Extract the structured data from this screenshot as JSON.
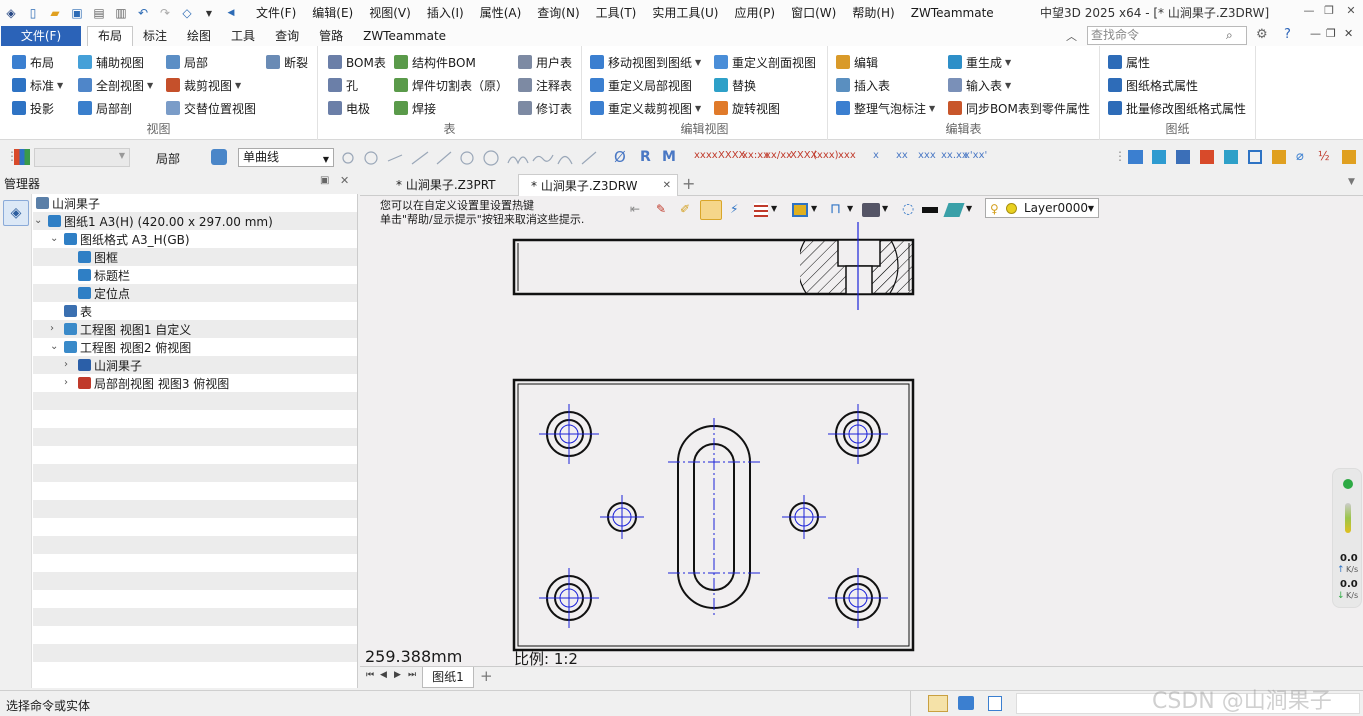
{
  "titlebar": {
    "menus": [
      "文件(F)",
      "编辑(E)",
      "视图(V)",
      "插入(I)",
      "属性(A)",
      "查询(N)",
      "工具(T)",
      "实用工具(U)",
      "应用(P)",
      "窗口(W)",
      "帮助(H)",
      "ZWTeammate"
    ],
    "title": "中望3D 2025 x64 - [* 山涧果子.Z3DRW]"
  },
  "tabs": {
    "file": "文件(F)",
    "items": [
      "布局",
      "标注",
      "绘图",
      "工具",
      "查询",
      "管路",
      "ZWTeammate"
    ],
    "active": "布局",
    "search_placeholder": "查找命令"
  },
  "ribbon": {
    "view": {
      "label": "视图",
      "items": [
        "布局",
        "辅助视图",
        "局部",
        "断裂",
        "标准",
        "全剖视图",
        "裁剪视图",
        "投影",
        "局部剖",
        "交替位置视图"
      ]
    },
    "table": {
      "label": "表",
      "items": [
        "BOM表",
        "结构件BOM",
        "用户表",
        "孔",
        "焊件切割表（原）",
        "注释表",
        "电极",
        "焊接",
        "修订表"
      ]
    },
    "editview": {
      "label": "编辑视图",
      "items": [
        "移动视图到图纸",
        "重定义剖面视图",
        "重定义局部视图",
        "替换",
        "重定义裁剪视图",
        "旋转视图"
      ]
    },
    "edittable": {
      "label": "编辑表",
      "items": [
        "编辑",
        "重生成",
        "插入表",
        "输入表",
        "整理气泡标注",
        "同步BOM表到零件属性"
      ]
    },
    "drawing": {
      "label": "图纸",
      "items": [
        "属性",
        "图纸格式属性",
        "批量修改图纸格式属性"
      ]
    }
  },
  "toolbar2": {
    "scope_label": "局部",
    "linetype": "单曲线",
    "layer": "Layer0000",
    "dim_tools": [
      "xxxx",
      "XXXX",
      "xx:xx",
      "xx/xx",
      "XXXX",
      "(xxx)",
      "xxx",
      "x",
      "xx",
      "xxx",
      "xx.xx",
      "x'xx'"
    ],
    "letters": [
      "Ø",
      "R",
      "M"
    ]
  },
  "manager": {
    "title": "管理器",
    "tree": [
      {
        "label": "山涧果子",
        "level": 0,
        "expander": "",
        "color": "#5a7fa8"
      },
      {
        "label": "图纸1 A3(H) (420.00 x 297.00 mm)",
        "level": 0,
        "expander": "v",
        "color": "#2f7fc5"
      },
      {
        "label": "图纸格式 A3_H(GB)",
        "level": 1,
        "expander": "v",
        "color": "#2f7fc5"
      },
      {
        "label": "图框",
        "level": 2,
        "expander": "",
        "color": "#2f7fc5"
      },
      {
        "label": "标题栏",
        "level": 2,
        "expander": "",
        "color": "#2f7fc5"
      },
      {
        "label": "定位点",
        "level": 2,
        "expander": "",
        "color": "#2f7fc5"
      },
      {
        "label": "表",
        "level": 1,
        "expander": "",
        "color": "#3a6fb0"
      },
      {
        "label": "工程图 视图1 自定义",
        "level": 1,
        "expander": ">",
        "color": "#3a8ac9"
      },
      {
        "label": "工程图 视图2 俯视图",
        "level": 1,
        "expander": "v",
        "color": "#3a8ac9"
      },
      {
        "label": "山涧果子",
        "level": 2,
        "expander": ">",
        "color": "#2b5fa8"
      },
      {
        "label": "局部剖视图 视图3 俯视图",
        "level": 2,
        "expander": ">",
        "color": "#c03a2b"
      }
    ]
  },
  "documents": {
    "tabs": [
      "* 山涧果子.Z3PRT",
      "* 山涧果子.Z3DRW"
    ],
    "active": 1
  },
  "canvas": {
    "hint_line1": "您可以在自定义设置里设置热键",
    "hint_line2": "单击\"帮助/显示提示\"按钮来取消这些提示.",
    "measure": "259.388mm",
    "scale": "比例:   1:2"
  },
  "speed": {
    "up": "0.0",
    "up_unit": "K/s",
    "down": "0.0",
    "down_unit": "K/s"
  },
  "sheets": [
    "图纸1"
  ],
  "status": {
    "message": "选择命令或实体"
  },
  "watermark": "CSDN @山涧果子",
  "colors": {
    "accent": "#2b63b8",
    "centerline": "#1b22d8",
    "geometry": "#111111"
  }
}
